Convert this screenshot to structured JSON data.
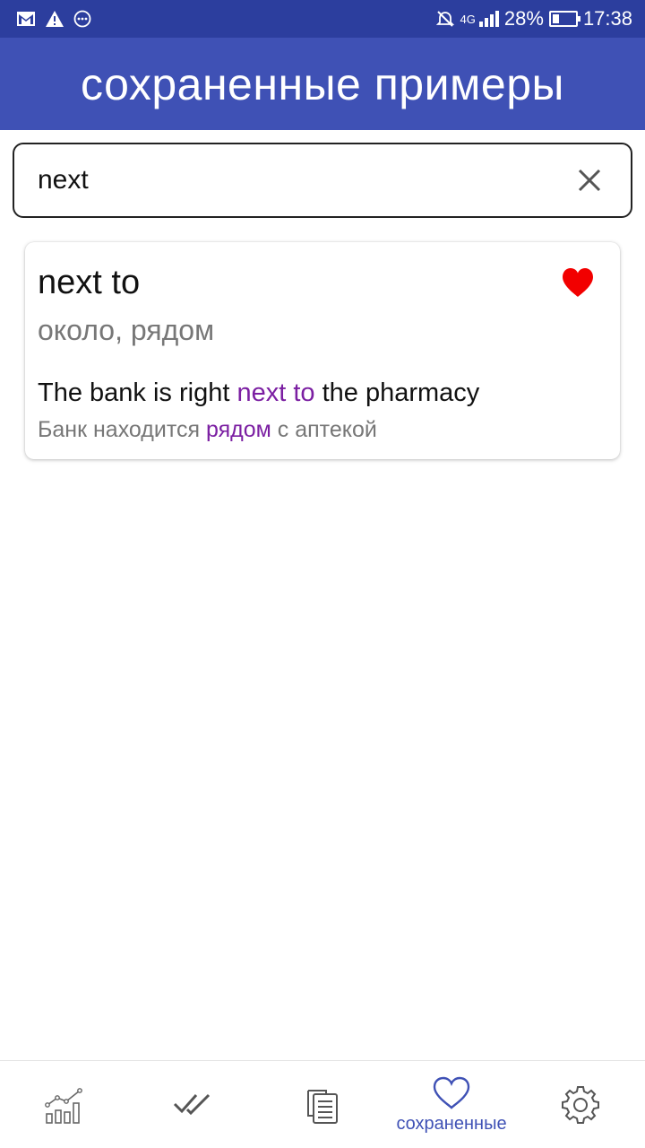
{
  "status_bar": {
    "icons": [
      "gmail-icon",
      "warning-icon",
      "more-icon"
    ],
    "network": "4G",
    "battery": "28%",
    "battery_level": 0.28,
    "time": "17:38"
  },
  "app_bar": {
    "title": "сохраненные примеры"
  },
  "search": {
    "value": "next",
    "placeholder": ""
  },
  "card": {
    "term": "next to",
    "translation": "около, рядом",
    "favorite": true,
    "example": {
      "before": "The bank is right ",
      "highlight": "next to",
      "after": " the pharmacy"
    },
    "example_translation": {
      "before": "Банк находится ",
      "highlight": "рядом",
      "after": " с аптекой"
    }
  },
  "bottom_nav": {
    "items": [
      {
        "icon": "stats-icon",
        "label": ""
      },
      {
        "icon": "double-check-icon",
        "label": ""
      },
      {
        "icon": "documents-icon",
        "label": ""
      },
      {
        "icon": "heart-outline-icon",
        "label": "сохраненные",
        "active": true
      },
      {
        "icon": "gear-icon",
        "label": ""
      }
    ]
  },
  "colors": {
    "status_bar": "#2c3e9e",
    "app_bar": "#3f51b5",
    "highlight": "#7b1fa2",
    "heart": "#f20000"
  }
}
